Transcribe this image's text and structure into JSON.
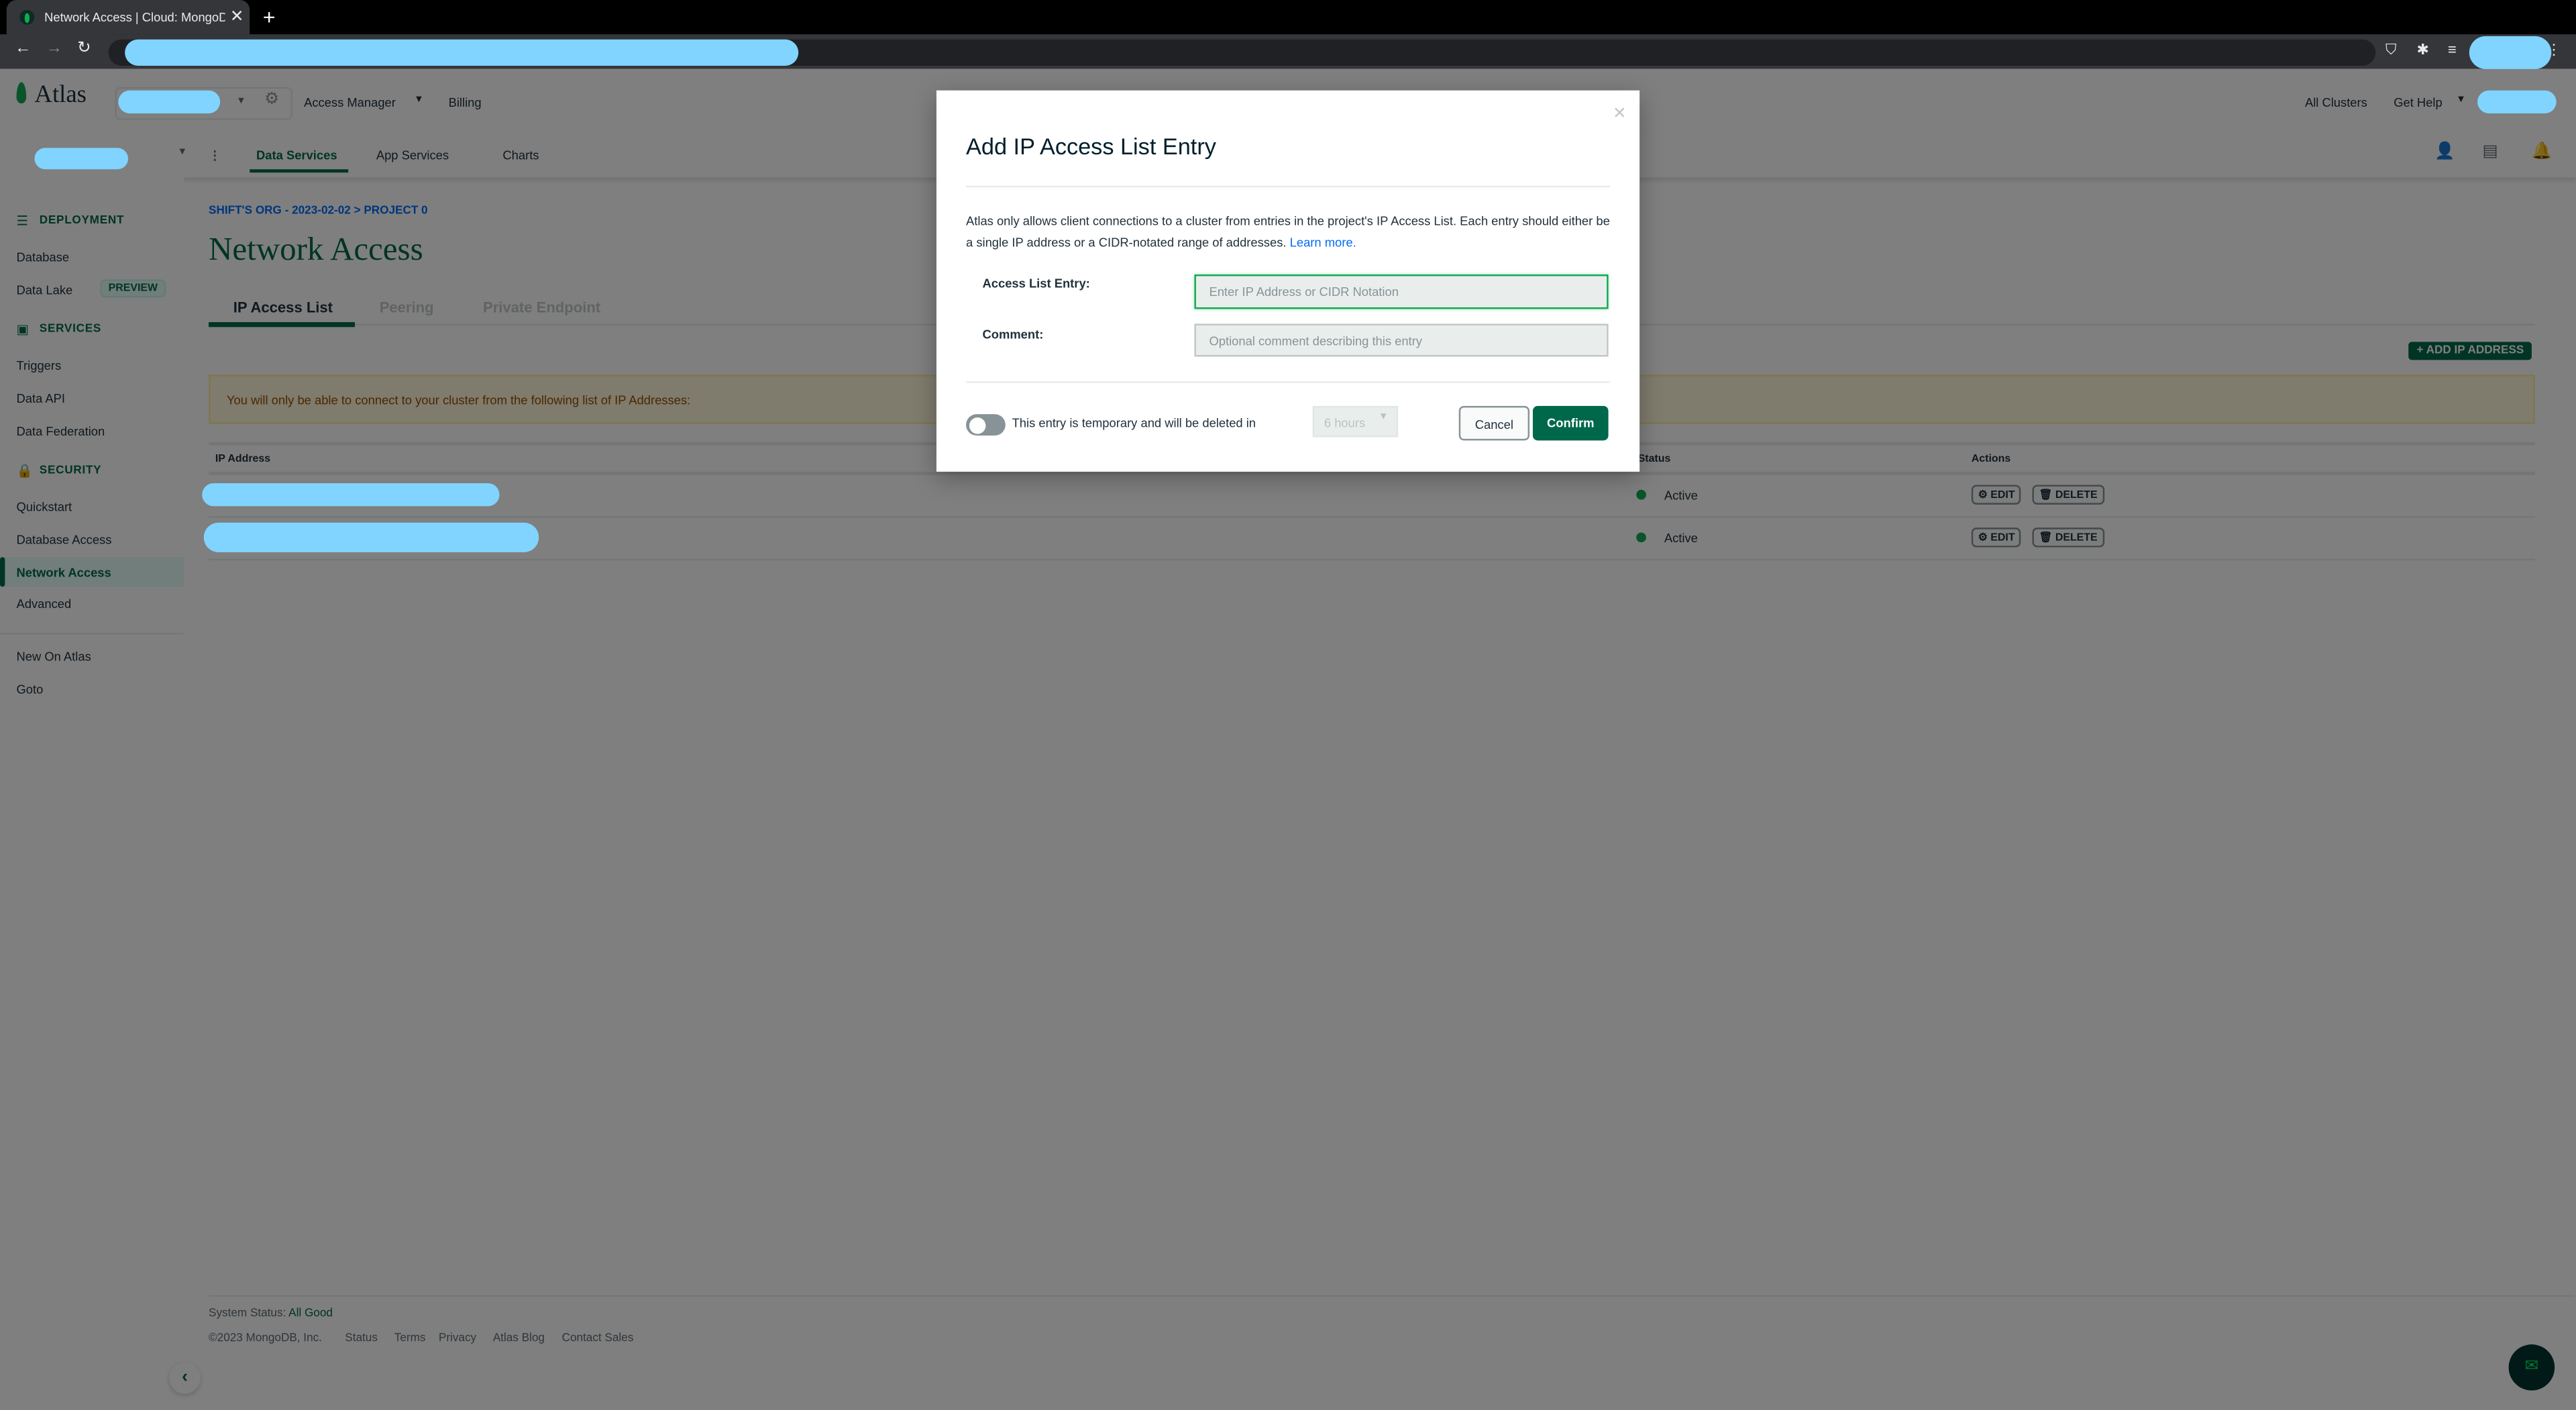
{
  "browser": {
    "tab_title": "Network Access | Cloud: MongoDB Cloud",
    "new_tab": "+",
    "close": "✕"
  },
  "header": {
    "logo": "Atlas",
    "access_manager": "Access Manager",
    "billing": "Billing",
    "all_clusters": "All Clusters",
    "get_help": "Get Help"
  },
  "nav": {
    "tabs": [
      "Data Services",
      "App Services",
      "Charts"
    ]
  },
  "sidebar": {
    "deployment": "DEPLOYMENT",
    "database": "Database",
    "data_lake": "Data Lake",
    "preview": "PREVIEW",
    "services": "SERVICES",
    "triggers": "Triggers",
    "data_api": "Data API",
    "data_federation": "Data Federation",
    "security": "SECURITY",
    "quickstart": "Quickstart",
    "database_access": "Database Access",
    "network_access": "Network Access",
    "advanced": "Advanced",
    "new_on_atlas": "New On Atlas",
    "goto": "Goto"
  },
  "main": {
    "breadcrumb": "SHIFT'S ORG - 2023-02-02 > PROJECT 0",
    "title": "Network Access",
    "tabs": [
      "IP Access List",
      "Peering",
      "Private Endpoint"
    ],
    "add_ip": "+ ADD IP ADDRESS",
    "warning": "You will only be able to connect to your cluster from the following list of IP Addresses:",
    "columns": {
      "ip": "IP Address",
      "status": "Status",
      "actions": "Actions"
    },
    "rows": [
      {
        "status": "Active",
        "edit": "⚙ EDIT",
        "delete": "🗑 DELETE"
      },
      {
        "status": "Active",
        "edit": "⚙ EDIT",
        "delete": "🗑 DELETE"
      }
    ]
  },
  "footer": {
    "system_status": "System Status:",
    "status_value": "All Good",
    "copyright": "©2023 MongoDB, Inc.",
    "links": [
      "Status",
      "Terms",
      "Privacy",
      "Atlas Blog",
      "Contact Sales"
    ]
  },
  "modal": {
    "title": "Add IP Access List Entry",
    "description": "Atlas only allows client connections to a cluster from entries in the project's IP Access List. Each entry should either be a single IP address or a CIDR-notated range of addresses.",
    "learn_more": "Learn more.",
    "entry_label": "Access List Entry:",
    "entry_placeholder": "Enter IP Address or CIDR Notation",
    "comment_label": "Comment:",
    "comment_placeholder": "Optional comment describing this entry",
    "temporary_text": "This entry is temporary and will be deleted in",
    "duration": "6 hours",
    "cancel": "Cancel",
    "confirm": "Confirm",
    "temporary_enabled": false
  },
  "colors": {
    "brand": "#00684a",
    "active": "#13aa52",
    "link": "#016bf8",
    "redaction": "#80d4ff"
  }
}
